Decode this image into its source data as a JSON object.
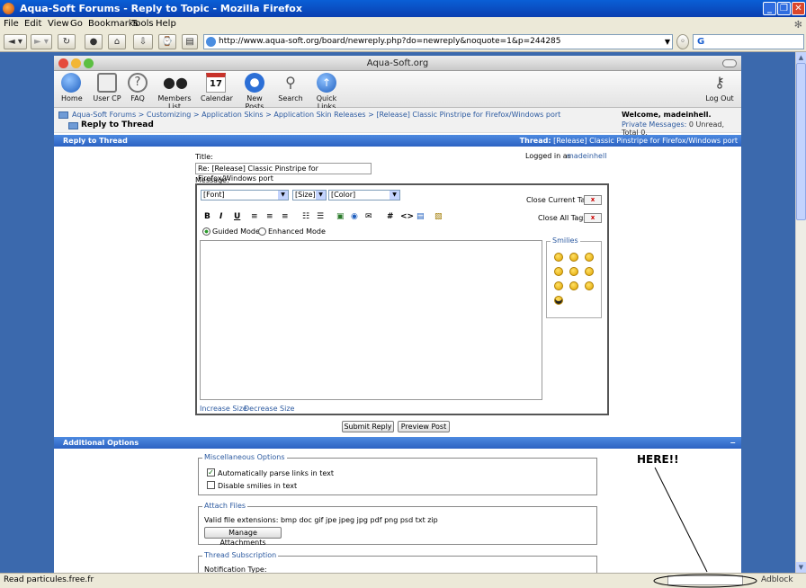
{
  "window": {
    "title": "Aqua-Soft Forums - Reply to Topic - Mozilla Firefox",
    "min": "_",
    "max": "❐",
    "close": "✕"
  },
  "menu": [
    "File",
    "Edit",
    "View",
    "Go",
    "Bookmarks",
    "Tools",
    "Help"
  ],
  "nav": {
    "url": "http://www.aqua-soft.org/board/newreply.php?do=newreply&noquote=1&p=244285",
    "search_engine": "G"
  },
  "app": {
    "title": "Aqua-Soft.org",
    "toolbar": [
      "Home",
      "User CP",
      "FAQ",
      "Members List",
      "Calendar",
      "New Posts",
      "Search",
      "Quick Links"
    ],
    "calendar_day": "17",
    "logout": "Log Out"
  },
  "breadcrumb": {
    "path": "Aqua-Soft Forums > Customizing > Application Skins > Application Skin Releases > [Release] Classic Pinstripe for Firefox/Windows port",
    "title": "Reply to Thread",
    "welcome": "Welcome, madeinhell.",
    "pm_label": "Private Messages:",
    "pm_value": "0 Unread, Total 0."
  },
  "reply_bar": {
    "label": "Reply to Thread",
    "thread_label": "Thread:",
    "thread_value": "[Release] Classic Pinstripe for Firefox/Windows port"
  },
  "form": {
    "title_label": "Title:",
    "title_value": "Re: [Release] Classic Pinstripe for Firefox/Windows port",
    "logged_in_label": "Logged in as",
    "logged_in_user": "madeinhell",
    "message_label": "Message:",
    "font_select": "[Font]",
    "size_select": "[Size]",
    "color_select": "[Color]",
    "close_current_tag": "Close Current Tag",
    "close_all_tags": "Close All Tags",
    "close_x": "x",
    "format": {
      "bold": "B",
      "italic": "I",
      "underline": "U",
      "hash": "#",
      "code": "<>"
    },
    "guided_mode": "Guided Mode",
    "enhanced_mode": "Enhanced Mode",
    "smilies_label": "Smilies",
    "increase_size": "Increase Size",
    "decrease_size": "Decrease Size",
    "submit": "Submit Reply",
    "preview": "Preview Post"
  },
  "additional": {
    "label": "Additional Options",
    "collapse": "−",
    "misc_legend": "Miscellaneous Options",
    "parse_links": "Automatically parse links in text",
    "disable_smilies": "Disable smilies in text",
    "attach_legend": "Attach Files",
    "valid_ext": "Valid file extensions: bmp doc gif jpe jpeg jpg pdf png psd txt zip",
    "manage_attachments": "Manage Attachments",
    "subscription_legend": "Thread Subscription",
    "notification_type": "Notification Type:"
  },
  "annotation": "HERE!!",
  "status": {
    "text": "Read particules.free.fr",
    "adblock": "Adblock"
  }
}
